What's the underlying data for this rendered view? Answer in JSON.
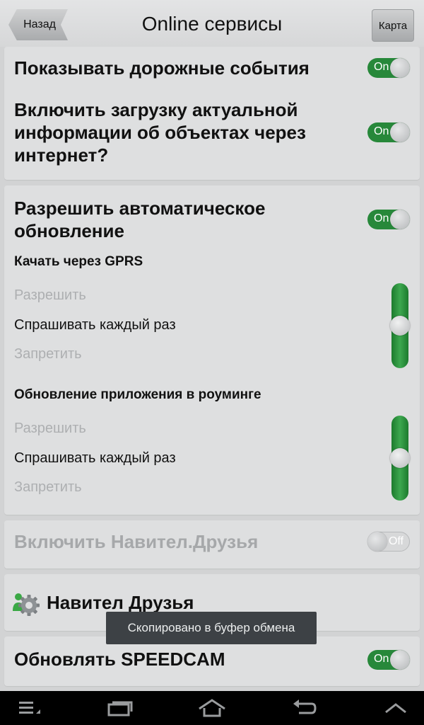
{
  "header": {
    "back_label": "Назад",
    "title": "Online сервисы",
    "map_label": "Карта"
  },
  "card1": {
    "traffic_label": "Показывать дорожные события",
    "traffic_toggle": "On",
    "download_line1": "Включить загрузку актуальной",
    "download_line2": "информации об объектах через",
    "download_line3": "интернет?",
    "download_toggle": "On"
  },
  "card2": {
    "autoupdate_line1": "Разрешить автоматическое",
    "autoupdate_line2": "обновление",
    "autoupdate_toggle": "On",
    "gprs": {
      "label": "Качать через GPRS",
      "options": [
        "Разрешить",
        "Спрашивать каждый раз",
        "Запретить"
      ],
      "selected_index": 1
    },
    "roaming": {
      "label": "Обновление приложения в роуминге",
      "options": [
        "Разрешить",
        "Спрашивать каждый раз",
        "Запретить"
      ],
      "selected_index": 1
    }
  },
  "card3": {
    "friends_enable_label": "Включить Навител.Друзья",
    "friends_enable_toggle": "Off"
  },
  "card4": {
    "friends_label": "Навител Друзья",
    "icon": "friends-gear-icon"
  },
  "card5": {
    "speedcam_label": "Обновлять SPEEDCAM",
    "speedcam_toggle": "On"
  },
  "toast": {
    "message": "Скопировано в буфер обмена"
  },
  "navbar": {
    "icons": [
      "menu-icon",
      "recent-apps-icon",
      "home-icon",
      "back-icon",
      "up-icon"
    ]
  },
  "colors": {
    "accent_green": "#27883a",
    "background": "#d2d3d4",
    "card": "#dedfe0"
  }
}
